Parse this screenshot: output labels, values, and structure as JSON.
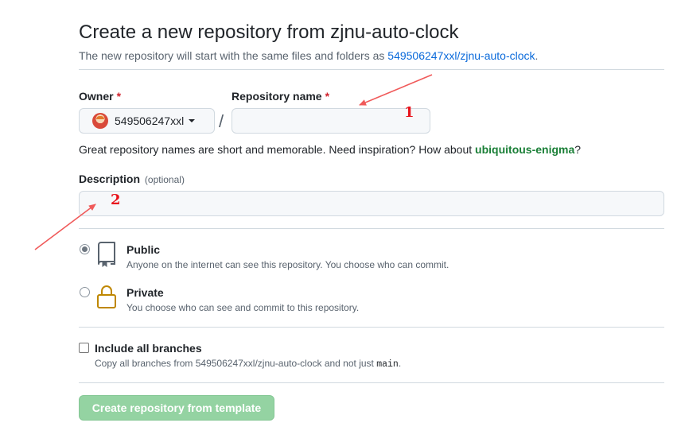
{
  "header": {
    "title": "Create a new repository from zjnu-auto-clock",
    "subtitle_prefix": "The new repository will start with the same files and folders as ",
    "template_link": "549506247xxl/zjnu-auto-clock",
    "subtitle_suffix": "."
  },
  "owner": {
    "label": "Owner",
    "required_mark": "*",
    "value": "549506247xxl"
  },
  "repo_name": {
    "label": "Repository name",
    "required_mark": "*",
    "value": "",
    "separator": "/"
  },
  "hint": {
    "text": "Great repository names are short and memorable. Need inspiration? How about ",
    "suggestion": "ubiquitous-enigma",
    "suffix": "?"
  },
  "description": {
    "label": "Description",
    "optional": "(optional)",
    "value": ""
  },
  "visibility": {
    "public": {
      "title": "Public",
      "desc": "Anyone on the internet can see this repository. You choose who can commit.",
      "selected": true,
      "icon": "repo-icon"
    },
    "private": {
      "title": "Private",
      "desc": "You choose who can see and commit to this repository.",
      "selected": false,
      "icon": "lock-icon"
    }
  },
  "include_branches": {
    "title": "Include all branches",
    "desc_prefix": "Copy all branches from 549506247xxl/zjnu-auto-clock and not just ",
    "desc_code": "main",
    "desc_suffix": ".",
    "checked": false
  },
  "submit": {
    "label": "Create repository from template"
  },
  "annotations": {
    "marker_1": "1",
    "marker_2": "2",
    "color": "#e8141c"
  }
}
